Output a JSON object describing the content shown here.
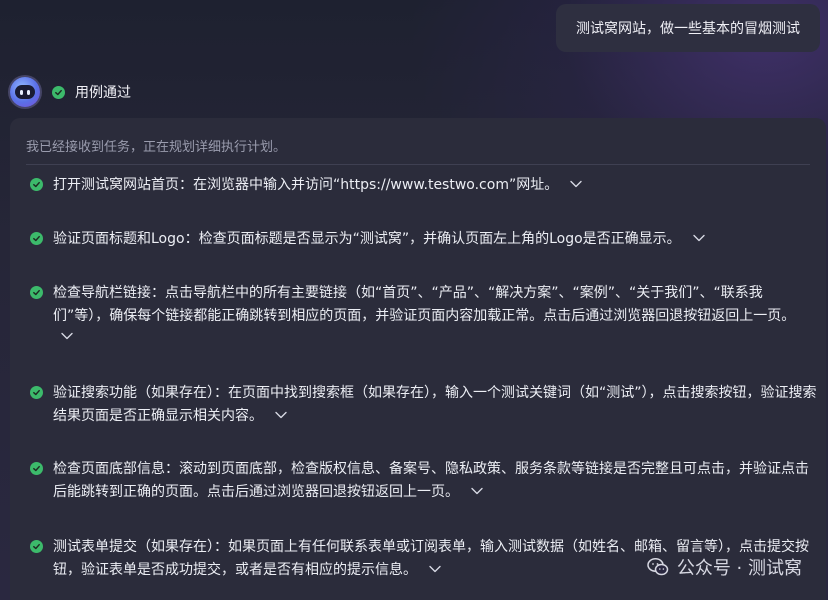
{
  "user_message": "测试窝网站，做一些基本的冒烟测试",
  "bot": {
    "status_label": "用例通过",
    "avatar_icon": "robot-icon",
    "status_icon": "check-circle-icon"
  },
  "panel": {
    "intro": "我已经接收到任务，正在规划详细执行计划。",
    "steps": [
      {
        "text": "打开测试窝网站首页：在浏览器中输入并访问“https://www.testwo.com”网址。"
      },
      {
        "text": "验证页面标题和Logo：检查页面标题是否显示为“测试窝”，并确认页面左上角的Logo是否正确显示。"
      },
      {
        "text": "检查导航栏链接：点击导航栏中的所有主要链接（如“首页”、“产品”、“解决方案”、“案例”、“关于我们”、“联系我们”等），确保每个链接都能正确跳转到相应的页面，并验证页面内容加载正常。点击后通过浏览器回退按钮返回上一页。"
      },
      {
        "text": "验证搜索功能（如果存在）：在页面中找到搜索框（如果存在），输入一个测试关键词（如“测试”），点击搜索按钮，验证搜索结果页面是否正确显示相关内容。"
      },
      {
        "text": "检查页面底部信息：滚动到页面底部，检查版权信息、备案号、隐私政策、服务条款等链接是否完整且可点击，并验证点击后能跳转到正确的页面。点击后通过浏览器回退按钮返回上一页。"
      },
      {
        "text": "测试表单提交（如果存在）：如果页面上有任何联系表单或订阅表单，输入测试数据（如姓名、邮箱、留言等），点击提交按钮，验证表单是否成功提交，或者是否有相应的提示信息。"
      }
    ]
  },
  "watermark": {
    "text": "公众号 · 测试窝",
    "icon": "wechat-icon"
  },
  "colors": {
    "success": "#3cba6b",
    "panel_bg": "#2b2c3b",
    "bubble_bg": "#2e2f40"
  }
}
